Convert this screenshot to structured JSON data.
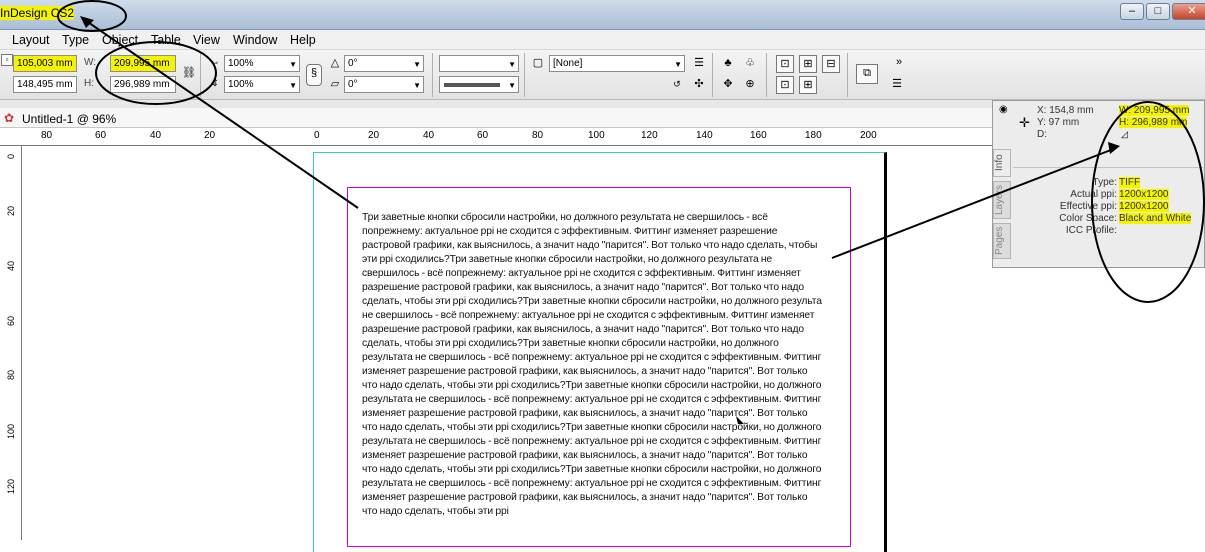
{
  "window": {
    "app_title": "InDesign CS2",
    "minimize": "–",
    "maximize": "□",
    "close": "✕"
  },
  "menu": [
    "Layout",
    "Type",
    "Object",
    "Table",
    "View",
    "Window",
    "Help"
  ],
  "control": {
    "x": "105,003 mm",
    "y": "148,495 mm",
    "w_label": "W:",
    "w": "209,995 mm",
    "h_label": "H:",
    "h": "296,989 mm",
    "scale_x": "100%",
    "scale_y": "100%",
    "rotate": "0°",
    "shear": "0°",
    "object_style": "[None]"
  },
  "document": {
    "tab_title": "Untitled-1 @ 96%"
  },
  "rulers": {
    "h": [
      "80",
      "60",
      "40",
      "20",
      "0",
      "20",
      "40",
      "60",
      "80",
      "100",
      "120",
      "140",
      "160",
      "180",
      "200"
    ],
    "v": [
      "0",
      "20",
      "40",
      "60",
      "80",
      "100",
      "120"
    ]
  },
  "body_text": "Три заветные кнопки сбросили настройки, но должного результата не свершилось - всё попрежнему: актуальное ppi не сходится с эффективным. Фиттинг изменяет разрешение растровой графики, как выяснилось, а значит надо \"парится\". Вот только что надо сделать, чтобы эти ppi сходились?Три заветные кнопки сбросили настройки, но должного результата не свершилось - всё попрежнему: актуальное ppi не сходится с эффективным. Фиттинг изменяет разрешение растровой графики, как выяснилось, а значит надо \"парится\". Вот только что надо сделать, чтобы эти ppi сходились?Три заветные кнопки сбросили настройки, но должного результа не свершилось - всё попрежнему: актуальное ppi не сходится с эффективным. Фиттинг изменяет разрешение растровой графики, как выяснилось, а значит надо \"парится\". Вот только что надо сделать, чтобы эти ppi сходились?Три заветные кнопки сбросили настройки, но должного результата не свершилось - всё попрежнему: актуальное ppi не сходится с эффективным. Фиттинг изменяет разрешение растровой графики, как выяснилось, а значит надо \"парится\". Вот только что надо сделать, чтобы эти ppi сходились?Три заветные кнопки сбросили настройки, но должного результата не свершилось - всё попрежнему: актуальное ppi не сходится с эффективным. Фиттинг изменяет разрешение растровой графики, как выяснилось, а значит надо \"парится\". Вот только что надо сделать, чтобы эти ppi сходились?Три заветные кнопки сбросили настройки, но должного результата не свершилось - всё попрежнему: актуальное ppi не сходится с эффективным. Фиттинг изменяет разрешение растровой графики, как выяснилось, а значит надо \"парится\". Вот только что надо сделать, чтобы эти ppi сходились?Три заветные кнопки сбросили настройки, но должного результата не свершилось - всё попрежнему: актуальное ppi не сходится с эффективным. Фиттинг изменяет разрешение растровой графики, как выяснилось, а значит надо \"парится\". Вот только что надо сделать, чтобы эти ppi",
  "info_panel": {
    "tabs": [
      "Info",
      "Layers",
      "Pages"
    ],
    "x": "X: 154,8 mm",
    "y": "Y: 97 mm",
    "d": "D:",
    "w": "W: 209,995 mm",
    "h": "H: 296,989 mm",
    "type_label": "Type:",
    "type": "TIFF",
    "actual_label": "Actual ppi:",
    "actual": "1200x1200",
    "effective_label": "Effective ppi:",
    "effective": "1200x1200",
    "colorspace_label": "Color Space:",
    "colorspace": "Black and White",
    "icc_label": "ICC Profile:"
  },
  "colors": {
    "highlight": "#f4f400",
    "page_guide": "#33cccc",
    "margin_guide": "#cc00cc"
  }
}
